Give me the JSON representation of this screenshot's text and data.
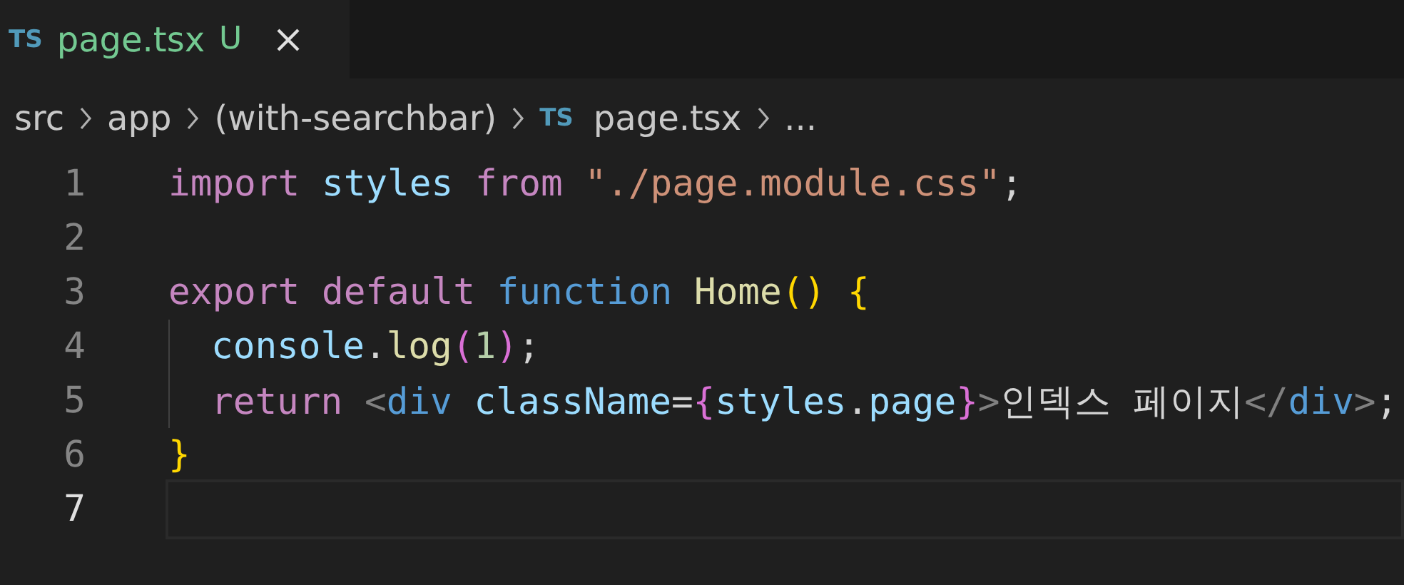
{
  "tabs": [
    {
      "icon": "TS",
      "label": "page.tsx",
      "status": "U",
      "selected": true
    }
  ],
  "breadcrumb": [
    {
      "label": "src"
    },
    {
      "label": "app"
    },
    {
      "label": "(with-searchbar)"
    },
    {
      "icon": "TS",
      "label": "page.tsx"
    },
    {
      "label": "..."
    }
  ],
  "editor": {
    "lines": [
      {
        "number": "1",
        "active": false,
        "indent_guide": false,
        "tokens": [
          {
            "kind": "keyword",
            "text": "import"
          },
          {
            "kind": "variable",
            "text": " styles"
          },
          {
            "kind": "keyword",
            "text": " from"
          },
          {
            "kind": "string",
            "text": " \"./page.module.css\""
          },
          {
            "kind": "plain",
            "text": ";"
          }
        ]
      },
      {
        "number": "2",
        "active": false,
        "indent_guide": false
      },
      {
        "number": "3",
        "active": false,
        "indent_guide": false,
        "tokens": [
          {
            "kind": "keyword",
            "text": "export"
          },
          {
            "kind": "keyword",
            "text": " default"
          },
          {
            "kind": "storage",
            "text": " function"
          },
          {
            "kind": "function",
            "text": " Home"
          },
          {
            "kind": "bracket1",
            "text": "()"
          },
          {
            "kind": "bracket1",
            "text": " {"
          }
        ]
      },
      {
        "number": "4",
        "active": false,
        "indent_guide": true,
        "tokens": [
          {
            "kind": "variable",
            "text": "console"
          },
          {
            "kind": "plain",
            "text": "."
          },
          {
            "kind": "function",
            "text": "log"
          },
          {
            "kind": "bracket2",
            "text": "("
          },
          {
            "kind": "number",
            "text": "1"
          },
          {
            "kind": "bracket2",
            "text": ")"
          },
          {
            "kind": "plain",
            "text": ";"
          }
        ]
      },
      {
        "number": "5",
        "active": false,
        "indent_guide": true,
        "tokens": [
          {
            "kind": "keyword",
            "text": "return"
          },
          {
            "kind": "tagbracket",
            "text": " <"
          },
          {
            "kind": "storage",
            "text": "div"
          },
          {
            "kind": "variable",
            "text": " className"
          },
          {
            "kind": "plain",
            "text": "="
          },
          {
            "kind": "bracket2",
            "text": "{"
          },
          {
            "kind": "variable",
            "text": "styles"
          },
          {
            "kind": "plain",
            "text": "."
          },
          {
            "kind": "variable",
            "text": "page"
          },
          {
            "kind": "bracket2",
            "text": "}"
          },
          {
            "kind": "tagbracket",
            "text": ">"
          },
          {
            "kind": "plain",
            "text": "인덱스 페이지"
          },
          {
            "kind": "tagbracket",
            "text": "</"
          },
          {
            "kind": "storage",
            "text": "div"
          },
          {
            "kind": "tagbracket",
            "text": ">"
          },
          {
            "kind": "plain",
            "text": ";"
          }
        ]
      },
      {
        "number": "6",
        "active": false,
        "indent_guide": false,
        "tokens": [
          {
            "kind": "bracket1",
            "text": "}"
          }
        ]
      },
      {
        "number": "7",
        "active": true,
        "indent_guide": false
      }
    ]
  }
}
